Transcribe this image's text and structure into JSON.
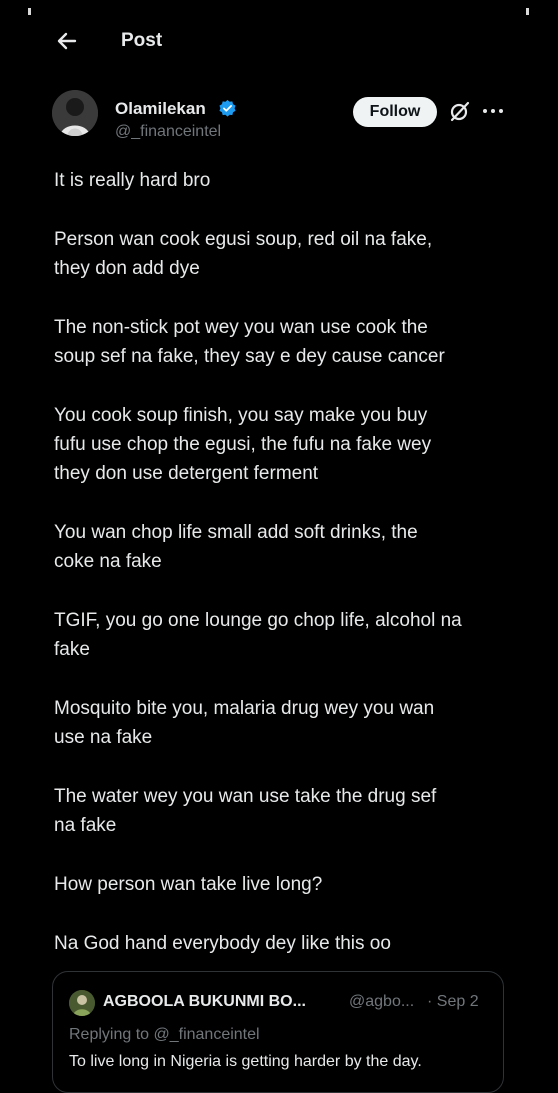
{
  "header": {
    "title": "Post",
    "back_icon": "arrow-left-icon"
  },
  "author": {
    "name": "Olamilekan",
    "handle": "@_financeintel",
    "verified": true,
    "verified_color": "#1d9bf0"
  },
  "actions": {
    "follow_label": "Follow",
    "grok_icon": "slashed-circle-icon",
    "more_icon": "ellipsis-icon"
  },
  "tweet": {
    "paragraphs": [
      "It is really hard bro",
      "Person wan cook egusi soup, red oil na fake,\nthey don add dye",
      "The non-stick pot wey you wan use cook the\nsoup sef na fake, they say e dey cause cancer",
      "You cook soup finish, you say make you buy\nfufu use chop the egusi, the fufu na fake wey\nthey don use detergent ferment",
      "You wan chop life small add soft drinks, the\ncoke na fake",
      "TGIF, you go one lounge go chop life, alcohol na\nfake",
      "Mosquito bite you, malaria drug wey you wan\nuse na fake",
      "The water wey you wan use take the drug sef\nna fake",
      "How person wan take live long?",
      "Na God hand everybody dey like this oo"
    ]
  },
  "quote": {
    "name": "AGBOOLA BUKUNMI BO...",
    "handle": "@agbo...",
    "date": "· Sep 2",
    "replying_to": "Replying to @_financeintel",
    "text": "To live long in Nigeria is getting harder by the day."
  },
  "colors": {
    "background": "#000000",
    "text": "#e7e9ea",
    "secondary": "#71767b",
    "border": "#2f3336"
  }
}
